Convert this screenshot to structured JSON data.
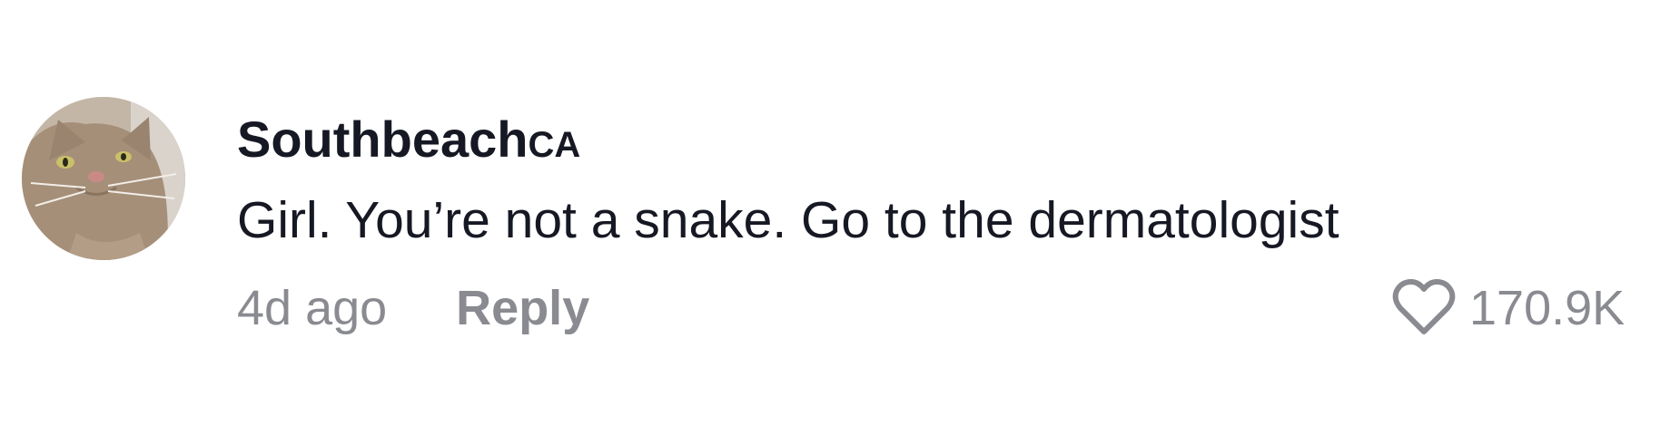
{
  "comment": {
    "username": "Southbeach",
    "username_suffix": "CA",
    "text": "Girl. You’re not a snake. Go to the dermatologist",
    "timestamp": "4d ago",
    "reply_label": "Reply",
    "like_count": "170.9K",
    "avatar_icon": "cat-avatar",
    "like_icon": "heart-outline-icon"
  },
  "colors": {
    "text_primary": "#161823",
    "text_secondary": "#8a8b91",
    "background": "#ffffff"
  }
}
